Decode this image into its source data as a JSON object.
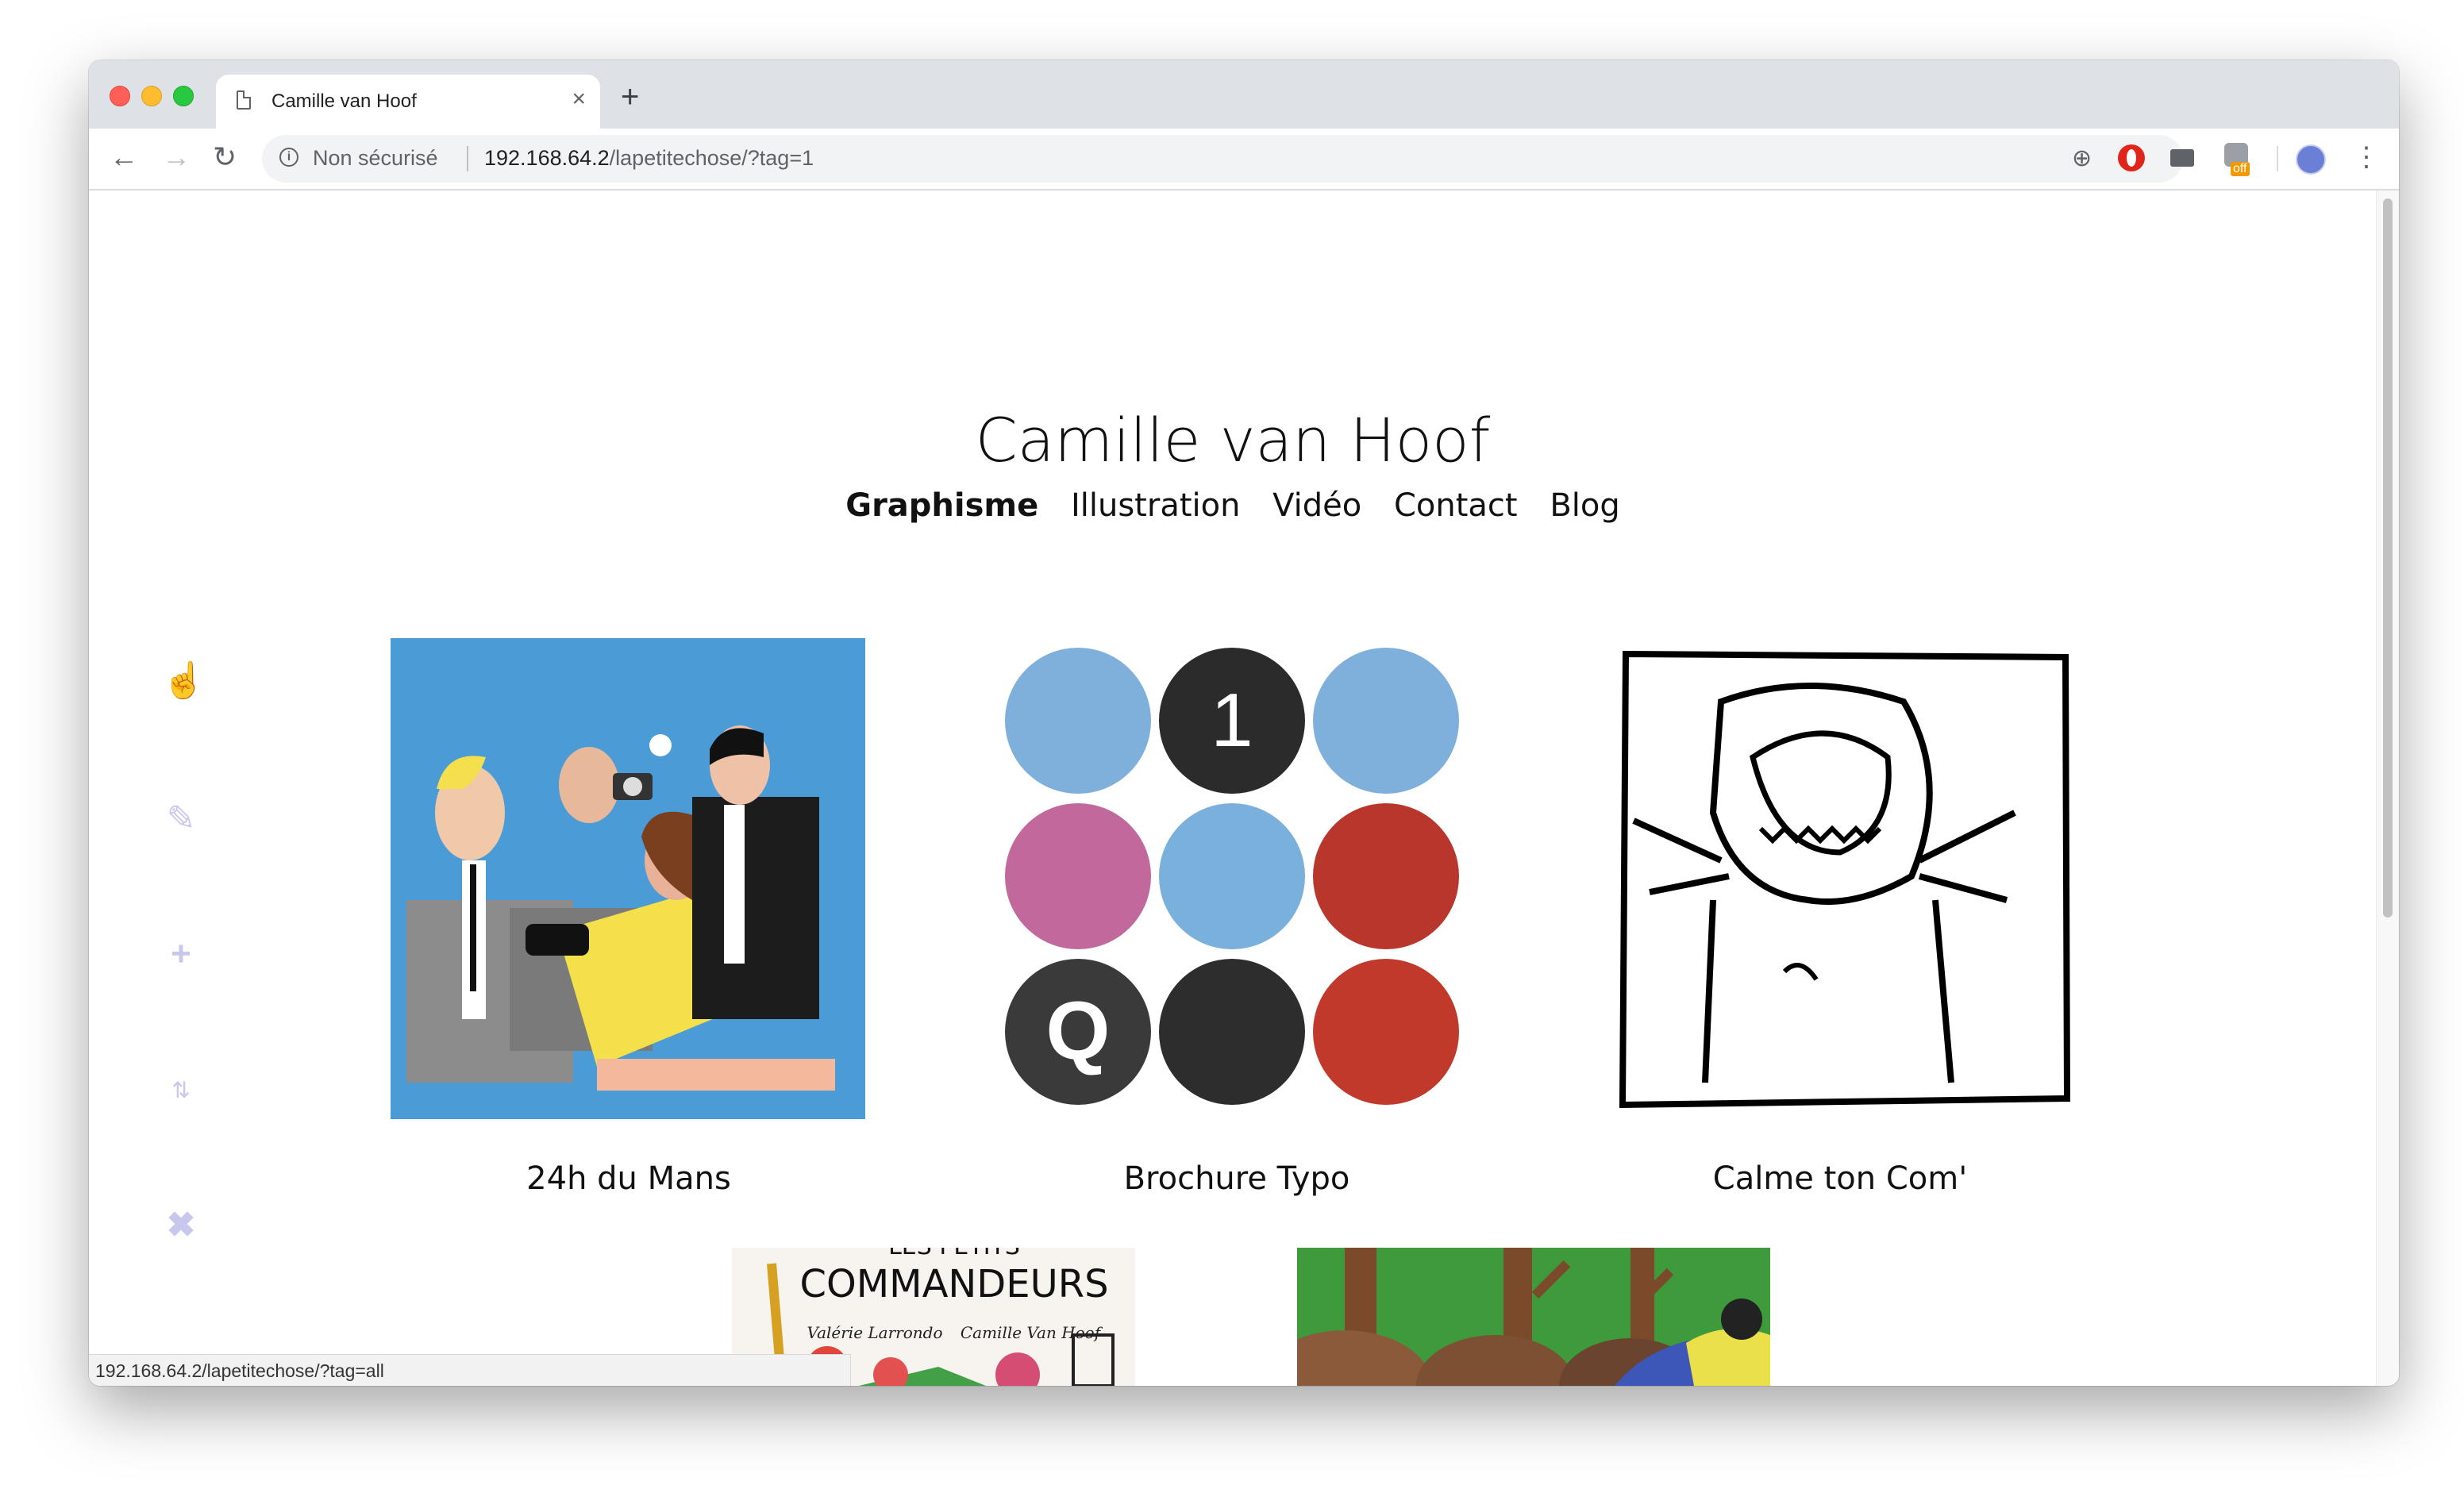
{
  "browser": {
    "tab_title": "Camille van Hoof",
    "tab_close": "×",
    "new_tab": "+",
    "security_label": "Non sécurisé",
    "url_host": "192.168.64.2",
    "url_path": "/lapetitechose/?tag=1",
    "ext_off_badge": "off",
    "status_url": "192.168.64.2/lapetitechose/?tag=all"
  },
  "site": {
    "title": "Camille van Hoof",
    "nav": [
      "Graphisme",
      "Illustration",
      "Vidéo",
      "Contact",
      "Blog"
    ],
    "active_nav": "Graphisme"
  },
  "sidebar_tools": [
    "hand-pointer-icon",
    "pencil-icon",
    "plus-icon",
    "sort-icon",
    "close-icon"
  ],
  "projects": [
    {
      "title": "24h du Mans"
    },
    {
      "title": "Brochure Typo"
    },
    {
      "title": "Calme ton Com'"
    }
  ],
  "brochure_letters": {
    "top": "1",
    "bottom": "Q"
  },
  "book_cover": {
    "heading": "COMMANDEURS",
    "top_fragment": "LES PETITS",
    "author_left": "Valérie Larrondo",
    "author_right": "Camille Van Hoof"
  },
  "colors": {
    "accent": "#6d6ad0",
    "accent_light": "#c8c7ee",
    "poster_blue": "#4b9bd6"
  }
}
